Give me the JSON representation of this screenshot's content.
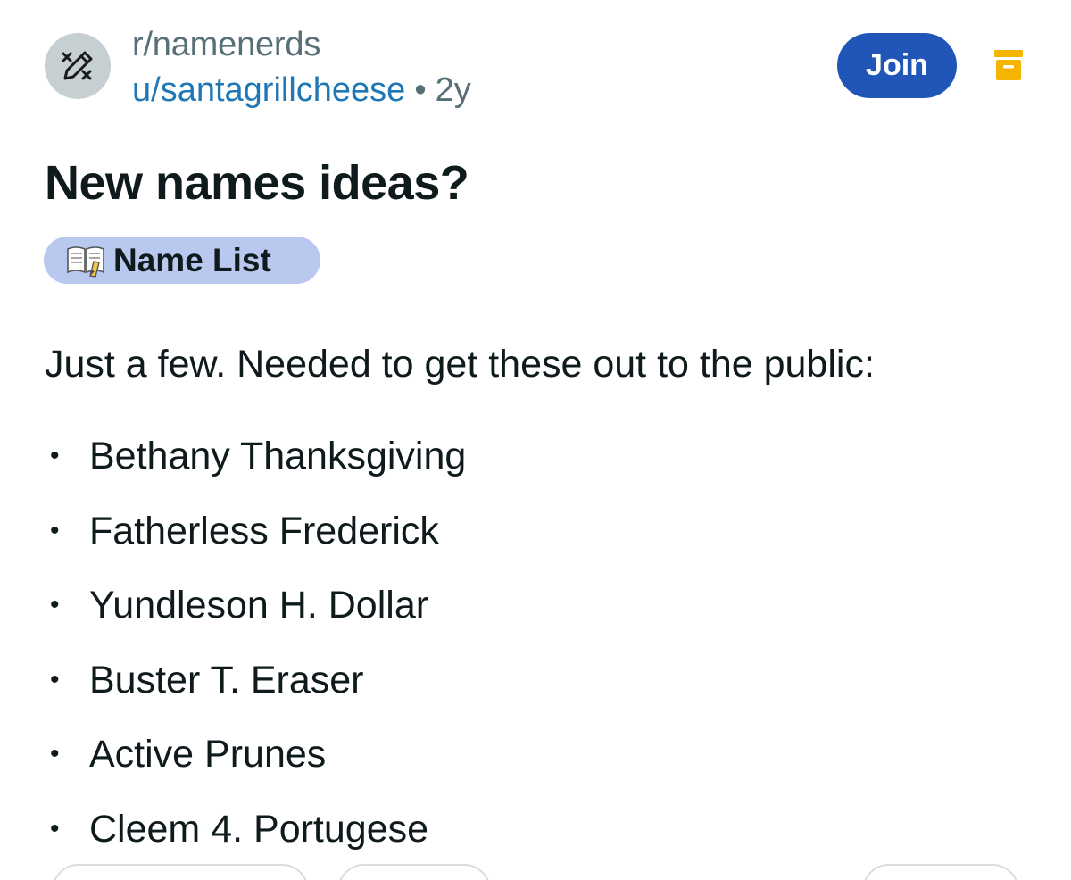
{
  "header": {
    "subreddit": "r/namenerds",
    "username": "u/santagrillcheese",
    "separator": "•",
    "age": "2y",
    "join_label": "Join",
    "avatar_icon": "pencil-brush-icon",
    "archive_icon": "archive-icon",
    "archive_color": "#f5b400"
  },
  "post": {
    "title": "New names ideas?",
    "flair": {
      "icon": "book-pencil-icon",
      "label": "Name List",
      "color": "#b8c8ee"
    },
    "intro": "Just a few. Needed to get these out to the public:",
    "bullet": "•",
    "names": [
      "Bethany Thanksgiving",
      "Fatherless Frederick",
      "Yundleson H. Dollar",
      "Buster T. Eraser",
      "Active Prunes",
      "Cleem 4. Portugese"
    ]
  },
  "colors": {
    "join_button": "#1f56b8",
    "username_link": "#1f77b6",
    "muted_text": "#576f76"
  }
}
